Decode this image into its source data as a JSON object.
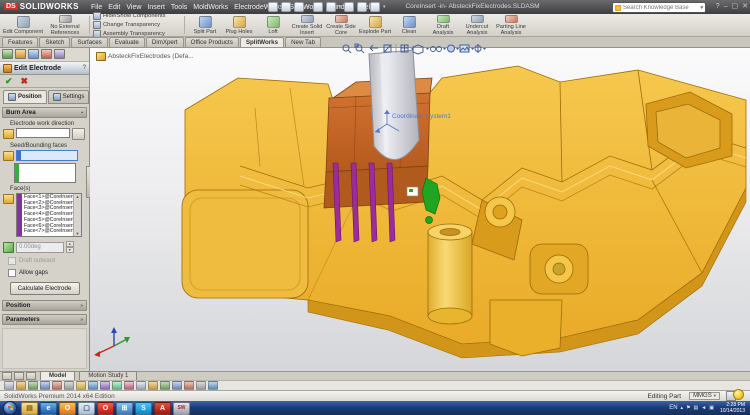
{
  "icons": {
    "ok": "✔",
    "cancel": "✖",
    "help": "?",
    "dropdown": "▾",
    "up": "▲",
    "down": "▼",
    "chevron": "»",
    "min": "–",
    "max": "▢",
    "close": "✕",
    "pin": "▪"
  },
  "title_bar": {
    "logo_prefix": "DS",
    "logo_text": "SOLIDWORKS",
    "menus": [
      "File",
      "Edit",
      "View",
      "Insert",
      "Tools",
      "MoldWorks",
      "ElectrodeWorks",
      "SplitWorks",
      "Window",
      "Help"
    ],
    "document_title": "CoreInsert -in- AbsteckFixElectrodes.SLDASM",
    "search_placeholder": "Search Knowledge Base"
  },
  "command_manager": {
    "left_buttons": [
      "Edit Component",
      "No External References"
    ],
    "stacked_buttons": [
      "Hide/Show Components",
      "Change Transparency",
      "Assembly Transparency"
    ],
    "buttons": [
      "Split Part",
      "Plug Holes",
      "Loft",
      "Create Solid Insert",
      "Create Side Core",
      "Explode Part",
      "Clean",
      "Draft Analysis",
      "Undercut Analysis",
      "Parting Line Analysis"
    ],
    "tabs": [
      "Features",
      "Sketch",
      "Surfaces",
      "Evaluate",
      "DimXpert",
      "Office Products",
      "SplitWorks",
      "New Tab"
    ],
    "active_tab": "SplitWorks"
  },
  "property_manager": {
    "title": "Edit Electrode",
    "tabs": [
      "Position",
      "Settings"
    ],
    "active_tab": "Position",
    "burn_area": {
      "title": "Burn Area",
      "work_direction_label": "Electrode work direction",
      "seed_label": "Seed/Bounding faces",
      "faces_label": "Face(s)",
      "faces": [
        "Face<1>@CoreInsert-",
        "Face<2>@CoreInsert-",
        "Face<3>@CoreInsert-",
        "Face<4>@CoreInsert-",
        "Face<5>@CoreInsert-",
        "Face<6>@CoreInsert-",
        "Face<7>@CoreInsert-"
      ],
      "draft_value": "0.00deg",
      "draft_outward_label": "Draft outward",
      "allow_gaps_label": "Allow gaps",
      "calculate_label": "Calculate Electrode"
    },
    "collapsed_groups": [
      "Position",
      "Parameters"
    ]
  },
  "feature_tree": {
    "root": "AbsteckFixElectrodes (Defa..."
  },
  "viewport": {
    "coordinate_label": "Coordinate System1"
  },
  "bottom": {
    "tabs": [
      "Model",
      "Motion Study 1"
    ],
    "active_tab": "Model",
    "status_left": "SolidWorks Premium 2014 x64 Edition",
    "status_right": "Editing Part",
    "units": "MMGS"
  },
  "taskbar": {
    "language": "EN",
    "time": "2:28 PM",
    "date": "10/14/2013"
  },
  "colors": {
    "selection_blue": "#3b74c4",
    "seed_green": "#3faa3f",
    "faces_purple": "#8b2fa8",
    "model_yellow": "#f0b63a",
    "block_orange": "#c96b2a",
    "electrode_purple": "#9c2b9c",
    "highlight_green": "#1fa51f",
    "taskbar_blue": "#1d3b73"
  }
}
